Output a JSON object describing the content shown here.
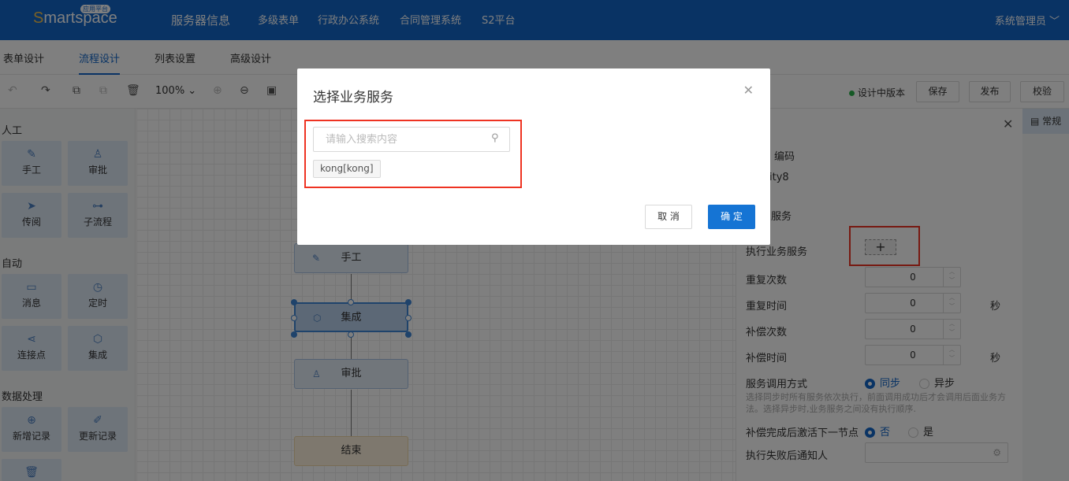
{
  "brand": {
    "name_s": "S",
    "name_rest": "martspace",
    "tag": "应用平台"
  },
  "nav": [
    "服务器信息",
    "多级表单",
    "行政办公系统",
    "合同管理系统",
    "S2平台"
  ],
  "user": "系统管理员",
  "tabs": [
    "表单设计",
    "流程设计",
    "列表设置",
    "高级设计"
  ],
  "active_tab": "流程设计",
  "toolbar": {
    "zoom": "100%",
    "version": "设计中版本",
    "save": "保存",
    "publish": "发布",
    "verify": "校验"
  },
  "palette": {
    "manual_section": "人工",
    "auto_section": "自动",
    "data_section": "数据处理",
    "items": {
      "manual": "手工",
      "approve": "审批",
      "circulate": "传阅",
      "subflow": "子流程",
      "message": "消息",
      "timer": "定时",
      "connector": "连接点",
      "integrate": "集成",
      "add_record": "新增记录",
      "update_record": "更新记录"
    }
  },
  "flow": {
    "n1": "手工",
    "n2": "集成",
    "n3": "审批",
    "n4": "结束"
  },
  "props": {
    "code_label": "编码",
    "code_value": "ity8",
    "service_label": "服务",
    "exec_service": "执行业务服务",
    "repeat_count": "重复次数",
    "repeat_time": "重复时间",
    "comp_count": "补偿次数",
    "comp_time": "补偿时间",
    "unit_sec": "秒",
    "v_repeat_count": "0",
    "v_repeat_time": "0",
    "v_comp_count": "0",
    "v_comp_time": "0",
    "call_mode": "服务调用方式",
    "sync": "同步",
    "async": "异步",
    "hint": "选择同步时所有服务依次执行，前面调用成功后才会调用后面业务方法。选择异步时,业务服务之间没有执行顺序.",
    "activate_next": "补偿完成后激活下一节点",
    "no": "否",
    "yes": "是",
    "notify": "执行失败后通知人",
    "side_tab": "常规"
  },
  "modal": {
    "title": "选择业务服务",
    "search_placeholder": "请输入搜索内容",
    "chip": "kong[kong]",
    "cancel": "取 消",
    "ok": "确 定"
  },
  "colors": {
    "header": "#1367c9",
    "primary_button": "#1574d4",
    "highlight": "#e32222"
  }
}
